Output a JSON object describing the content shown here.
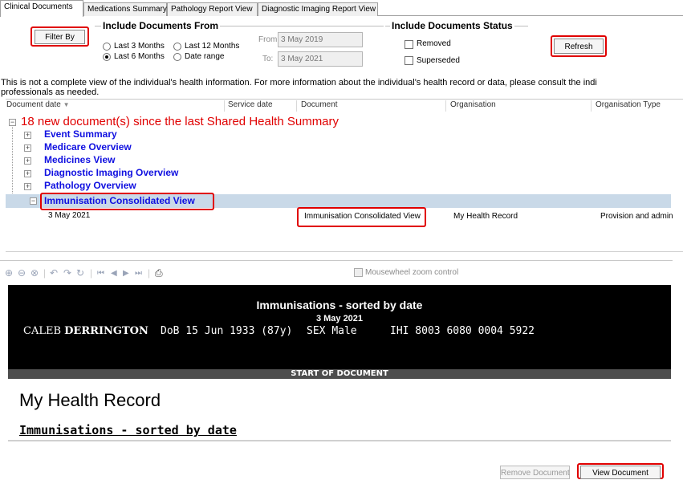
{
  "tabs": [
    "Clinical Documents",
    "Medications Summary",
    "Pathology Report View",
    "Diagnostic Imaging Report View"
  ],
  "filter": {
    "filter_by_label": "Filter By",
    "include_from_title": "Include Documents From",
    "opt_last3": "Last 3 Months",
    "opt_last12": "Last 12 Months",
    "opt_last6": "Last 6 Months",
    "opt_range": "Date range",
    "selected": "Last 6 Months",
    "from_label": "From:",
    "from_value": "3 May 2019",
    "to_label": "To:",
    "to_value": "3 May 2021"
  },
  "status": {
    "title": "Include Documents Status",
    "removed": "Removed",
    "superseded": "Superseded",
    "refresh_label": "Refresh"
  },
  "notice": {
    "line1": "This is not a complete view of the individual's health information. For more information about the individual's health record or data, please consult the indi",
    "line2": "professionals as needed."
  },
  "columns": [
    "Document date",
    "Service date",
    "Document",
    "Organisation",
    "Organisation Type"
  ],
  "tree": {
    "root": "18 new document(s) since the last Shared Health Summary",
    "items": [
      "Event Summary",
      "Medicare Overview",
      "Medicines View",
      "Diagnostic Imaging Overview",
      "Pathology Overview",
      "Immunisation Consolidated View"
    ]
  },
  "row": {
    "date": "3 May 2021",
    "document": "Immunisation Consolidated View",
    "organisation": "My Health Record",
    "org_type": "Provision and admin"
  },
  "viewer": {
    "zoom_control": "Mousewheel zoom control",
    "doc_title": "Immunisations - sorted by date",
    "doc_date": "3 May 2021",
    "patient_first": "CALEB",
    "patient_last": "DERRINGTON",
    "dob": "DoB 15 Jun 1933 (87y)",
    "sex_label": "SEX",
    "sex_value": "Male",
    "ihi": "IHI 8003 6080 0004 5922",
    "start_of_document": "START OF DOCUMENT",
    "heading": "My Health Record",
    "subheading": "Immunisations - sorted by date"
  },
  "actions": {
    "remove_label": "Remove Document",
    "view_label": "View Document"
  },
  "colors": {
    "highlight_red": "#e00000",
    "link_blue": "#1010e0",
    "selected_row": "#c9d9e8"
  }
}
